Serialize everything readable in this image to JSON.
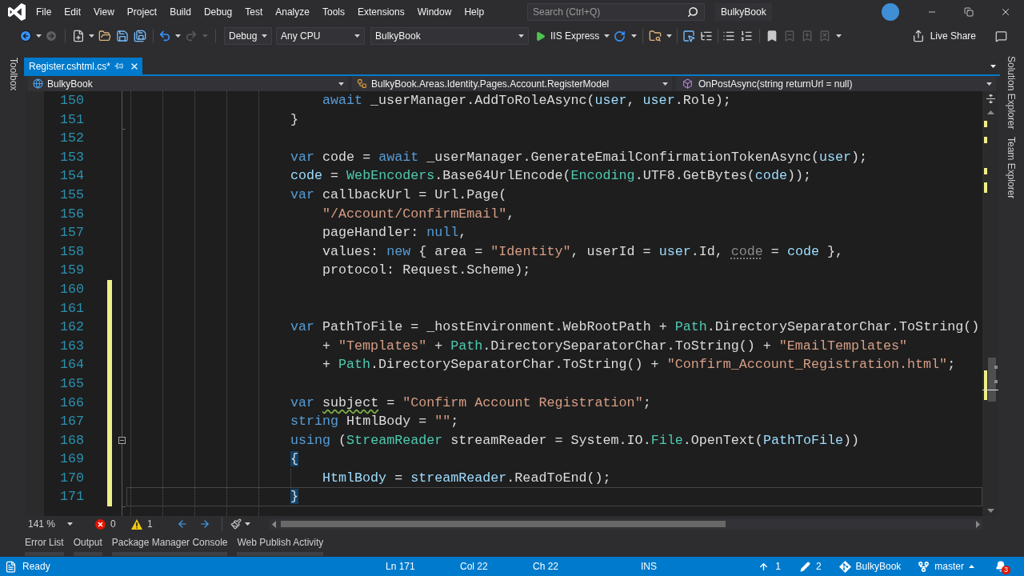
{
  "title_bar": {
    "menus": [
      "File",
      "Edit",
      "View",
      "Project",
      "Build",
      "Debug",
      "Test",
      "Analyze",
      "Tools",
      "Extensions",
      "Window",
      "Help"
    ],
    "search": {
      "placeholder": "Search (Ctrl+Q)"
    },
    "solution_name": "BulkyBook"
  },
  "toolbar": {
    "configuration": "Debug",
    "platform": "Any CPU",
    "startup_project": "BulkyBook",
    "run_target": "IIS Express",
    "live_share": "Live Share"
  },
  "left_side_tabs": [
    "Toolbox"
  ],
  "document_tabs": [
    {
      "label": "Register.cshtml.cs*",
      "selected": true
    }
  ],
  "navigation_bar": {
    "project": "BulkyBook",
    "type": "BulkyBook.Areas.Identity.Pages.Account.RegisterModel",
    "member": "OnPostAsync(string returnUrl = null)"
  },
  "editor": {
    "lines": [
      {
        "children": [
          {
            "number": "150",
            "changed": false,
            "current": false,
            "collapsible": false,
            "tokens": [
              {
                "kind": "keyword",
                "text": "await"
              },
              {
                "kind": "plain",
                "text": " _userManager.AddToRoleAsync("
              },
              {
                "kind": "variable",
                "text": "user"
              },
              {
                "kind": "plain",
                "text": ", "
              },
              {
                "kind": "variable",
                "text": "user"
              },
              {
                "kind": "plain",
                "text": ".Role);"
              }
            ]
          }
        ]
      },
      {
        "number": "151",
        "changed": false,
        "current": false,
        "collapsible": false,
        "tokens": [
          {
            "kind": "plain",
            "text": "}"
          }
        ]
      },
      {
        "number": "152",
        "changed": false,
        "current": false,
        "collapsible": false
      },
      {
        "number": "153",
        "changed": false,
        "current": false,
        "collapsible": false,
        "tokens": [
          {
            "kind": "keyword",
            "text": "var"
          },
          {
            "kind": "plain",
            "text": " code = "
          },
          {
            "kind": "keyword",
            "text": "await"
          },
          {
            "kind": "plain",
            "text": " _userManager.GenerateEmailConfirmationTokenAsync("
          },
          {
            "kind": "variable",
            "text": "user"
          },
          {
            "kind": "plain",
            "text": ");"
          }
        ]
      },
      {
        "number": "154",
        "changed": false,
        "current": false,
        "collapsible": false,
        "tokens": [
          {
            "kind": "variable",
            "text": "code"
          },
          {
            "kind": "plain",
            "text": " = "
          },
          {
            "kind": "type",
            "text": "WebEncoders"
          },
          {
            "kind": "plain",
            "text": ".Base64UrlEncode("
          },
          {
            "kind": "type",
            "text": "Encoding"
          },
          {
            "kind": "plain",
            "text": ".UTF8.GetBytes("
          },
          {
            "kind": "variable",
            "text": "code"
          },
          {
            "kind": "plain",
            "text": "));"
          }
        ]
      },
      {
        "number": "155",
        "changed": false,
        "current": false,
        "collapsible": false,
        "tokens": [
          {
            "kind": "keyword",
            "text": "var"
          },
          {
            "kind": "plain",
            "text": " callbackUrl = Url.Page("
          }
        ],
        "children": [
          {
            "number": "156",
            "changed": false,
            "current": false,
            "collapsible": false,
            "tokens": [
              {
                "kind": "string",
                "text": "\"/Account/ConfirmEmail\""
              },
              {
                "kind": "plain",
                "text": ","
              }
            ]
          },
          {
            "number": "157",
            "changed": false,
            "current": false,
            "collapsible": false,
            "tokens": [
              {
                "kind": "plain",
                "text": "pageHandler: "
              },
              {
                "kind": "keyword",
                "text": "null"
              },
              {
                "kind": "plain",
                "text": ","
              }
            ]
          },
          {
            "number": "158",
            "changed": false,
            "current": false,
            "collapsible": false,
            "tokens": [
              {
                "kind": "plain",
                "text": "values: "
              },
              {
                "kind": "keyword",
                "text": "new"
              },
              {
                "kind": "plain",
                "text": " { area = "
              },
              {
                "kind": "string",
                "text": "\"Identity\""
              },
              {
                "kind": "plain",
                "text": ", userId = "
              },
              {
                "kind": "variable",
                "text": "user"
              },
              {
                "kind": "plain",
                "text": ".Id, "
              },
              {
                "kind": "faded",
                "text": "code"
              },
              {
                "kind": "plain",
                "text": " = "
              },
              {
                "kind": "variable",
                "text": "code"
              },
              {
                "kind": "plain",
                "text": " },"
              }
            ]
          },
          {
            "number": "159",
            "changed": false,
            "current": false,
            "collapsible": false,
            "tokens": [
              {
                "kind": "plain",
                "text": "protocol: Request.Scheme);"
              }
            ]
          }
        ]
      },
      {
        "number": "160",
        "changed": true,
        "current": false,
        "collapsible": false
      },
      {
        "number": "161",
        "changed": true,
        "current": false,
        "collapsible": false
      },
      {
        "number": "162",
        "changed": true,
        "current": false,
        "collapsible": false,
        "tokens": [
          {
            "kind": "keyword",
            "text": "var"
          },
          {
            "kind": "plain",
            "text": " PathToFile = _hostEnvironment.WebRootPath + "
          },
          {
            "kind": "type",
            "text": "Path"
          },
          {
            "kind": "plain",
            "text": ".DirectorySeparatorChar.ToString()"
          }
        ],
        "children": [
          {
            "number": "163",
            "changed": true,
            "current": false,
            "collapsible": false,
            "tokens": [
              {
                "kind": "plain",
                "text": "+ "
              },
              {
                "kind": "string",
                "text": "\"Templates\""
              },
              {
                "kind": "plain",
                "text": " + "
              },
              {
                "kind": "type",
                "text": "Path"
              },
              {
                "kind": "plain",
                "text": ".DirectorySeparatorChar.ToString() + "
              },
              {
                "kind": "string",
                "text": "\"EmailTemplates\""
              }
            ]
          },
          {
            "number": "164",
            "changed": true,
            "current": false,
            "collapsible": false,
            "tokens": [
              {
                "kind": "plain",
                "text": "+ "
              },
              {
                "kind": "type",
                "text": "Path"
              },
              {
                "kind": "plain",
                "text": ".DirectorySeparatorChar.ToString() + "
              },
              {
                "kind": "string",
                "text": "\"Confirm_Account_Registration.html\""
              },
              {
                "kind": "plain",
                "text": ";"
              }
            ]
          }
        ]
      },
      {
        "number": "165",
        "changed": true,
        "current": false,
        "collapsible": false
      },
      {
        "number": "166",
        "changed": true,
        "current": false,
        "collapsible": false,
        "tokens": [
          {
            "kind": "keyword",
            "text": "var "
          },
          {
            "kind": "warning",
            "text": "subject"
          },
          {
            "kind": "plain",
            "text": " = "
          },
          {
            "kind": "string",
            "text": "\"Confirm Account Registration\""
          },
          {
            "kind": "plain",
            "text": ";"
          }
        ]
      },
      {
        "number": "167",
        "changed": true,
        "current": false,
        "collapsible": false,
        "tokens": [
          {
            "kind": "keyword",
            "text": "string"
          },
          {
            "kind": "plain",
            "text": " HtmlBody = "
          },
          {
            "kind": "string",
            "text": "\"\""
          },
          {
            "kind": "plain",
            "text": ";"
          }
        ]
      },
      {
        "number": "168",
        "changed": true,
        "current": false,
        "collapsible": true,
        "tokens": [
          {
            "kind": "keyword",
            "text": "using"
          },
          {
            "kind": "plain",
            "text": " ("
          },
          {
            "kind": "type",
            "text": "StreamReader"
          },
          {
            "kind": "plain",
            "text": " streamReader = System.IO."
          },
          {
            "kind": "type",
            "text": "File"
          },
          {
            "kind": "plain",
            "text": ".OpenText("
          },
          {
            "kind": "variable",
            "text": "PathToFile"
          },
          {
            "kind": "plain",
            "text": "))"
          }
        ]
      },
      {
        "number": "169",
        "changed": true,
        "current": false,
        "collapsible": false,
        "tokens": [
          {
            "kind": "brace",
            "text": "{"
          }
        ],
        "children": [
          {
            "number": "170",
            "changed": true,
            "current": false,
            "collapsible": false,
            "tokens": [
              {
                "kind": "variable",
                "text": "HtmlBody"
              },
              {
                "kind": "plain",
                "text": " = "
              },
              {
                "kind": "variable",
                "text": "streamReader"
              },
              {
                "kind": "plain",
                "text": ".ReadToEnd();"
              }
            ]
          }
        ]
      },
      {
        "number": "171",
        "changed": true,
        "current": true,
        "collapsible": false,
        "tokens": [
          {
            "kind": "brace",
            "text": "}"
          }
        ]
      }
    ]
  },
  "editor_footer": {
    "zoom": "141 %",
    "errors": "0",
    "warnings": "1"
  },
  "tool_tabs": [
    "Error List",
    "Output",
    "Package Manager Console",
    "Web Publish Activity"
  ],
  "right_side_tabs": [
    "Solution Explorer",
    "Team Explorer"
  ],
  "status_bar": {
    "message": "Ready",
    "line": "Ln 171",
    "column": "Col 22",
    "char": "Ch 22",
    "mode": "INS",
    "unpushed": "1",
    "changes": "2",
    "repository": "BulkyBook",
    "branch": "master",
    "notifications": "3"
  }
}
